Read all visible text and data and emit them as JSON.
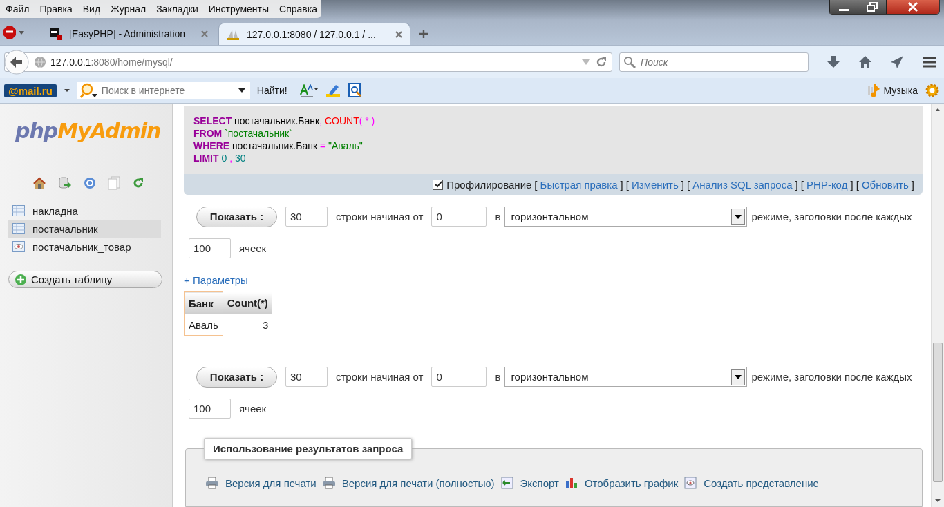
{
  "menu": [
    "Файл",
    "Правка",
    "Вид",
    "Журнал",
    "Закладки",
    "Инструменты",
    "Справка"
  ],
  "tabs": [
    {
      "title": "[EasyPHP] - Administration",
      "selected": false,
      "kind": "easyphp"
    },
    {
      "title": "127.0.0.1:8080 / 127.0.0.1 / ...",
      "selected": true,
      "kind": "pma"
    }
  ],
  "address": {
    "host": "127.0.0.1",
    "path": ":8080/home/mysql/"
  },
  "browser_search": {
    "placeholder": "Поиск"
  },
  "bookmarks": {
    "logo": "@mail.ru",
    "search_placeholder": "Поиск в интернете",
    "find_button": "Найти!",
    "music": "Музыка"
  },
  "sidebar": {
    "logo_left": "php",
    "logo_right": "MyAdmin",
    "tables": [
      {
        "name": "накладна",
        "selected": false,
        "kind": "table"
      },
      {
        "name": "постачальник",
        "selected": true,
        "kind": "table"
      },
      {
        "name": "постачальник_товар",
        "selected": false,
        "kind": "view"
      }
    ],
    "create_button": "Создать таблицу"
  },
  "sql": [
    [
      {
        "text": "SELECT",
        "kind": "keyword"
      },
      {
        "text": " постачальник.Банк",
        "kind": "plain"
      },
      {
        "text": ", ",
        "kind": "punct"
      },
      {
        "text": "COUNT",
        "kind": "func"
      },
      {
        "text": "( * )",
        "kind": "punct"
      }
    ],
    [
      {
        "text": "FROM",
        "kind": "keyword"
      },
      {
        "text": " `постачальник`",
        "kind": "string"
      }
    ],
    [
      {
        "text": "WHERE",
        "kind": "keyword"
      },
      {
        "text": " постачальник.Банк ",
        "kind": "plain"
      },
      {
        "text": "= ",
        "kind": "punct"
      },
      {
        "text": "\"Аваль\"",
        "kind": "string"
      }
    ],
    [
      {
        "text": "LIMIT",
        "kind": "keyword"
      },
      {
        "text": " 0 ",
        "kind": "number"
      },
      {
        "text": ",",
        "kind": "punct"
      },
      {
        "text": " 30",
        "kind": "number"
      }
    ]
  ],
  "profiling": {
    "checked": true,
    "label": "Профилирование",
    "brackets": [
      "[",
      "] [",
      "] [",
      "] [",
      "] [",
      "]"
    ],
    "links": [
      "Быстрая правка",
      "Изменить",
      "Анализ SQL запроса",
      "PHP-код",
      "Обновить"
    ]
  },
  "navigation": [
    {
      "button": "Показать :",
      "rows": "30",
      "rows_label": "строки начиная от",
      "start": "0",
      "in_label": "в",
      "mode": "горизонтальном",
      "mode_label": "режиме, заголовки после каждых",
      "repeat": "100",
      "repeat_label": "ячеек"
    },
    {
      "button": "Показать :",
      "rows": "30",
      "rows_label": "строки начиная от",
      "start": "0",
      "in_label": "в",
      "mode": "горизонтальном",
      "mode_label": "режиме, заголовки после каждых",
      "repeat": "100",
      "repeat_label": "ячеек"
    }
  ],
  "options_link": "+ Параметры",
  "results": {
    "columns": [
      "Банк",
      "Count(*)"
    ],
    "rows": [
      [
        "Аваль",
        "3"
      ]
    ]
  },
  "operations": {
    "legend": "Использование результатов запроса",
    "actions": [
      {
        "label": "Версия для печати",
        "kind": "print"
      },
      {
        "label": "Версия для печати (полностью)",
        "kind": "print"
      },
      {
        "label": "Экспорт",
        "kind": "export"
      },
      {
        "label": "Отобразить график",
        "kind": "chart"
      },
      {
        "label": "Создать представление",
        "kind": "view"
      }
    ]
  }
}
